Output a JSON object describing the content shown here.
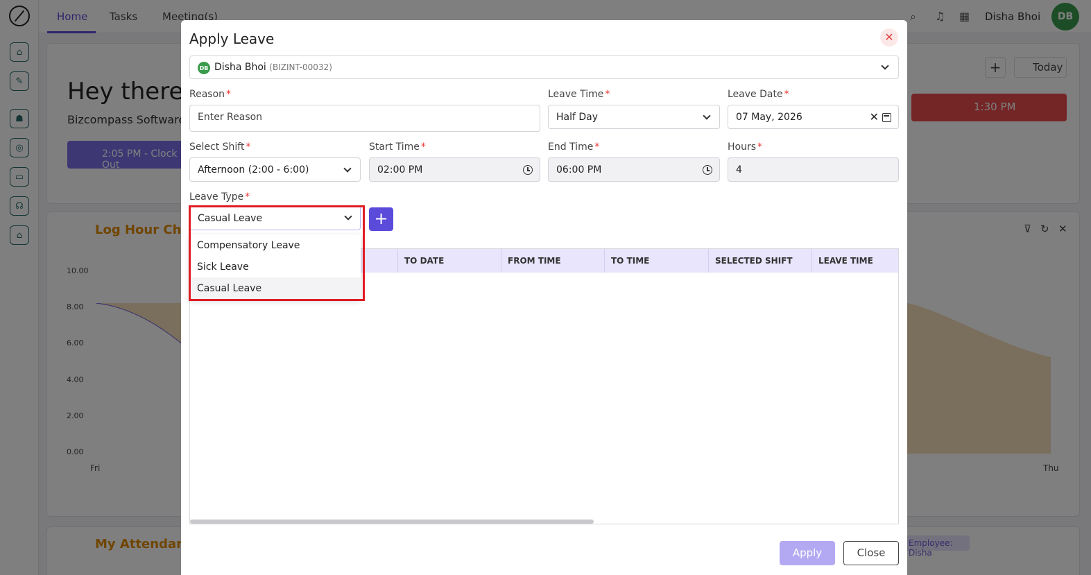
{
  "nav": {
    "tabs": [
      "Home",
      "Tasks",
      "Meeting(s)"
    ],
    "user_name": "Disha Bhoi",
    "avatar_initials": "DB"
  },
  "dashboard": {
    "greeting": "Hey there!",
    "company": "Bizcompass Software",
    "clock_button": "2:05 PM - Clock Out",
    "red_button_time": "1:30 PM",
    "today_label": "Today",
    "log_hour_title": "Log Hour Chart",
    "attendance_title": "My Attendance",
    "y_ticks": [
      "10.00",
      "8.00",
      "6.00",
      "4.00",
      "2.00",
      "0.00"
    ],
    "x_ticks": [
      "Fri",
      "Thu"
    ],
    "employee_filter": "Employee: Disha"
  },
  "modal": {
    "title": "Apply Leave",
    "employee": {
      "initials": "DB",
      "name": "Disha Bhoi",
      "code": "(BIZINT-00032)"
    },
    "reason": {
      "label": "Reason",
      "placeholder": "Enter Reason"
    },
    "leave_time": {
      "label": "Leave Time",
      "value": "Half Day"
    },
    "leave_date": {
      "label": "Leave Date",
      "value": "07 May, 2026"
    },
    "select_shift": {
      "label": "Select Shift",
      "value": "Afternoon (2:00 - 6:00)"
    },
    "start_time": {
      "label": "Start Time",
      "value": "02:00 PM"
    },
    "end_time": {
      "label": "End Time",
      "value": "06:00 PM"
    },
    "hours": {
      "label": "Hours",
      "value": "4"
    },
    "leave_type": {
      "label": "Leave Type",
      "value": "Casual Leave",
      "options": [
        "Compensatory Leave",
        "Sick Leave",
        "Casual Leave"
      ]
    },
    "table_headers": [
      "TO DATE",
      "FROM TIME",
      "TO TIME",
      "SELECTED SHIFT",
      "LEAVE TIME"
    ],
    "apply_label": "Apply",
    "close_label": "Close"
  },
  "colors": {
    "accent": "#5b4bdb",
    "highlight": "#e01b24",
    "required": "#e33333"
  }
}
